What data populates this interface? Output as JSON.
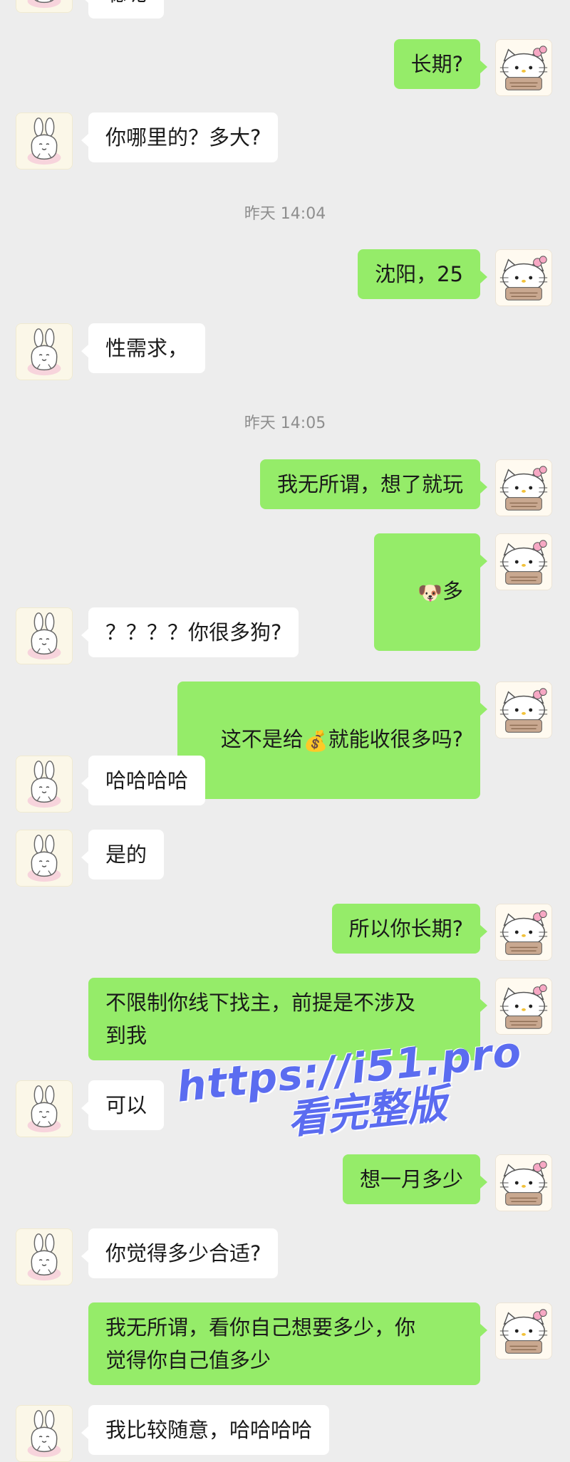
{
  "messages": {
    "m0": "聪呢",
    "m1": "长期?",
    "m2": "你哪里的？多大?",
    "t1": "昨天 14:04",
    "m3": "沈阳，25",
    "m4": "性需求，",
    "t2": "昨天 14:05",
    "m5": "我无所谓，想了就玩",
    "m6_text": "多",
    "m6_emoji": "🐶",
    "m7": "？？？？你很多狗?",
    "m8_a": "这不是给",
    "m8_emoji": "💰",
    "m8_b": "就能收很多吗?",
    "m9": "哈哈哈哈",
    "m10": "是的",
    "m11": "所以你长期?",
    "m12": "不限制你线下找主，前提是不涉及\n到我",
    "m13": "可以",
    "m14": "想一月多少",
    "m15": "你觉得多少合适?",
    "m16": "我无所谓，看你自己想要多少，你\n觉得你自己值多少",
    "m17": "我比较随意，哈哈哈哈"
  },
  "watermark": {
    "line1": "https://i51.pro",
    "line2": "看完整版"
  },
  "colors": {
    "background": "#ededed",
    "outgoing_bubble": "#95ec69",
    "incoming_bubble": "#ffffff",
    "watermark": "#5b6cf0"
  },
  "icons": {
    "left_avatar": "bunny-avatar-icon",
    "right_avatar": "hello-kitty-avatar-icon"
  }
}
